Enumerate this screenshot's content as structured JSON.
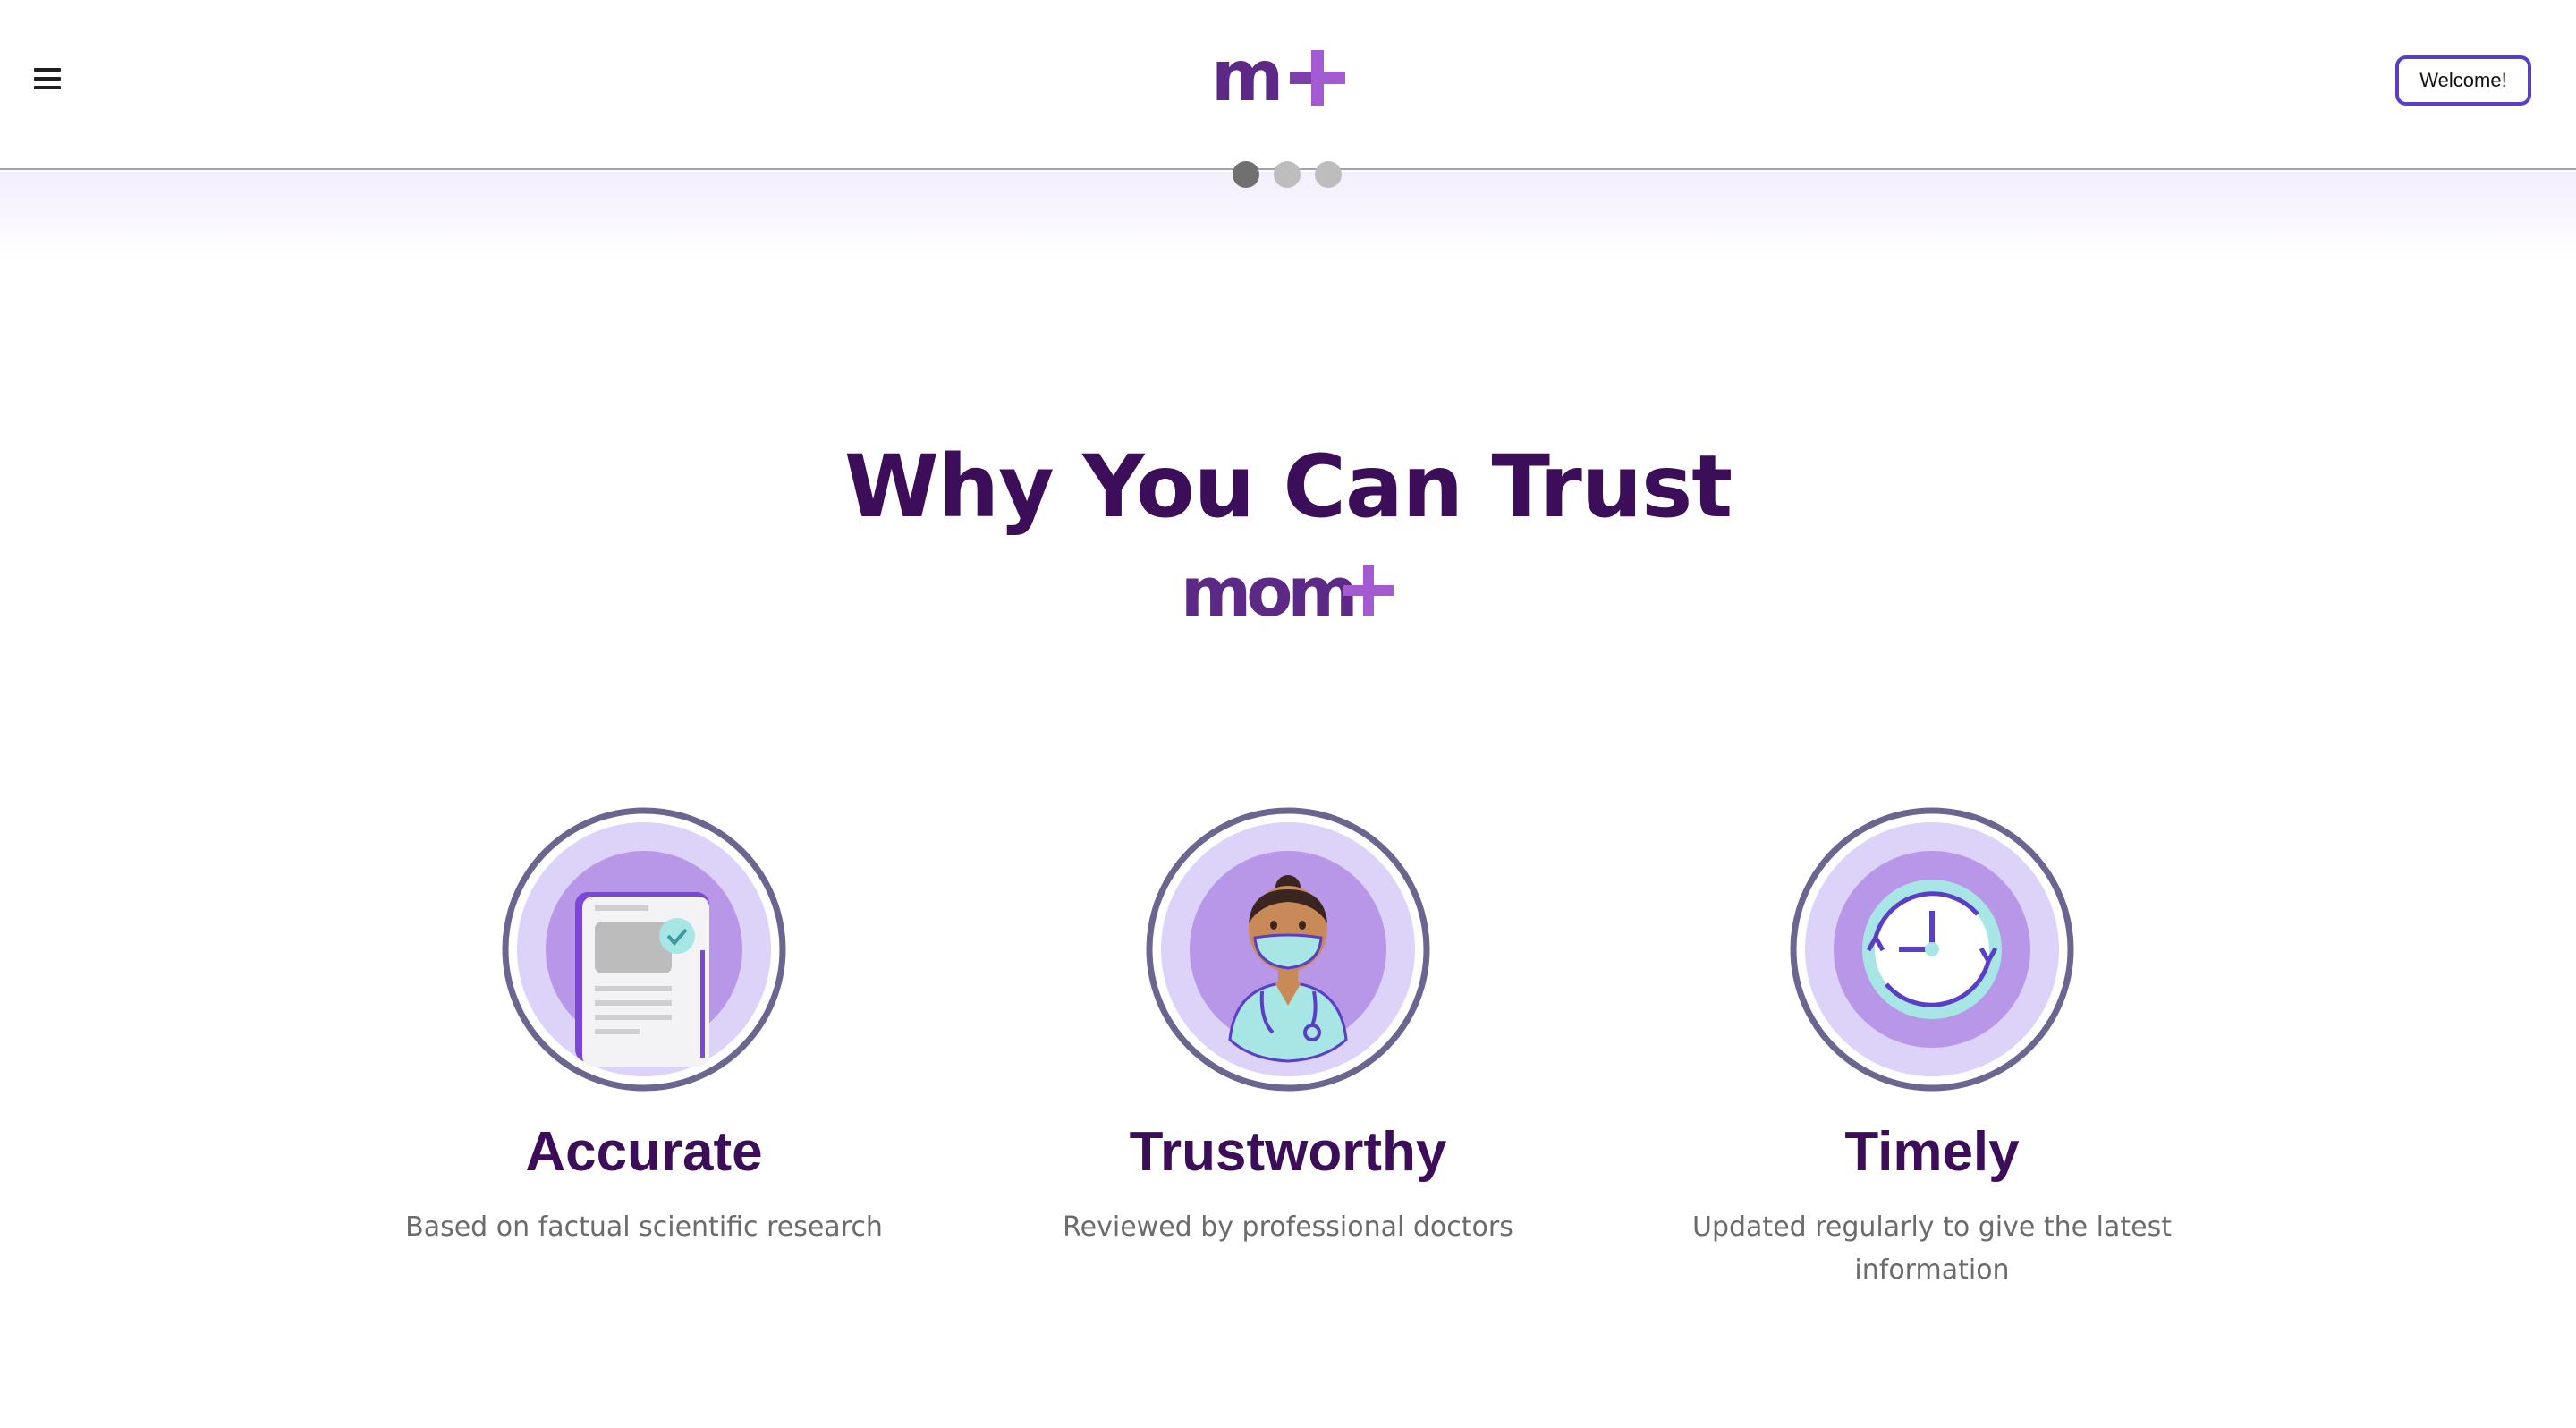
{
  "header": {
    "logo_text": "m+",
    "welcome_label": "Welcome!",
    "menu_icon": "hamburger-menu-icon"
  },
  "carousel": {
    "dots": 3,
    "active_index": 0
  },
  "trust": {
    "title": "Why You Can Trust",
    "brand": "mom+"
  },
  "features": [
    {
      "icon": "document-check-icon",
      "title": "Accurate",
      "description": "Based on factual scientific research"
    },
    {
      "icon": "doctor-icon",
      "title": "Trustworthy",
      "description": "Reviewed by professional doctors"
    },
    {
      "icon": "clock-refresh-icon",
      "title": "Timely",
      "description": "Updated regularly to give the latest information"
    }
  ],
  "colors": {
    "brand_dark": "#3c0d58",
    "brand_purple": "#5c2a86",
    "brand_plus": "#a45bd2",
    "button_border": "#5a3ec8"
  }
}
